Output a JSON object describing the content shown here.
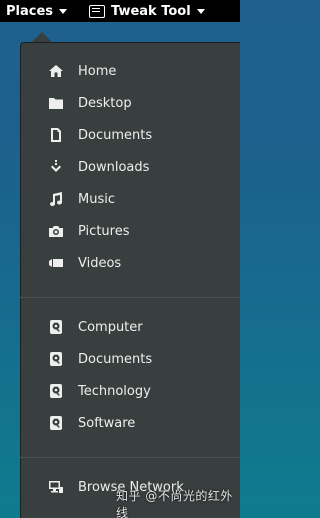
{
  "topbar": {
    "places_label": "Places",
    "tweak_label": "Tweak Tool"
  },
  "menu": {
    "places": [
      {
        "label": "Home",
        "icon": "home-icon"
      },
      {
        "label": "Desktop",
        "icon": "folder-icon"
      },
      {
        "label": "Documents",
        "icon": "document-icon"
      },
      {
        "label": "Downloads",
        "icon": "download-icon"
      },
      {
        "label": "Music",
        "icon": "music-icon"
      },
      {
        "label": "Pictures",
        "icon": "camera-icon"
      },
      {
        "label": "Videos",
        "icon": "video-icon"
      }
    ],
    "drives": [
      {
        "label": "Computer",
        "icon": "drive-icon"
      },
      {
        "label": "Documents",
        "icon": "drive-icon"
      },
      {
        "label": "Technology",
        "icon": "drive-icon"
      },
      {
        "label": "Software",
        "icon": "drive-icon"
      }
    ],
    "network": [
      {
        "label": "Browse Network",
        "icon": "network-icon"
      }
    ]
  },
  "watermark": "知乎 @不尚光的红外线",
  "colors": {
    "menu_bg": "#393f3f",
    "menu_text": "#eeeeec",
    "topbar_bg": "#000000"
  }
}
